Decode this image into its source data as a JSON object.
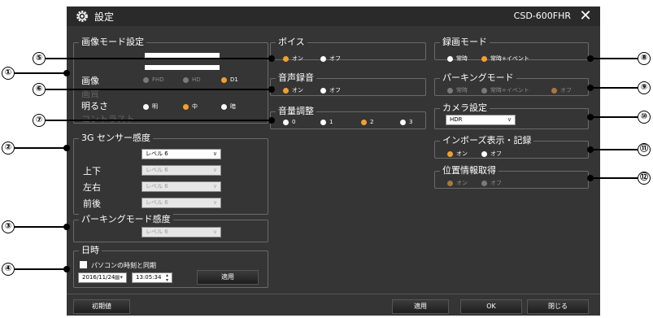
{
  "title": "設定",
  "model": "CSD-600FHR",
  "close": "✕",
  "image_mode": {
    "legend": "画像モード設定",
    "rows": [
      {
        "label": "画像",
        "options": [
          "FHD",
          "HD",
          "D1"
        ],
        "selected": 2
      },
      {
        "label": "明るさ",
        "options": [
          "明",
          "中",
          "暗"
        ],
        "selected": 1
      }
    ],
    "hidden_label_1": "画質",
    "hidden_label_2": "コントラスト"
  },
  "voice": {
    "legend": "ボイス",
    "options": [
      "オン",
      "オフ"
    ],
    "selected": 0
  },
  "audio_rec": {
    "legend": "音声録音",
    "options": [
      "オン",
      "オフ"
    ],
    "selected": 0
  },
  "volume": {
    "legend": "音量調整",
    "options": [
      "0",
      "1",
      "2",
      "3"
    ],
    "selected": 2
  },
  "rec_mode": {
    "legend": "録画モード",
    "options": [
      "常時",
      "常時+イベント"
    ],
    "selected": 1
  },
  "parking_mode": {
    "legend": "パーキングモード",
    "options": [
      "常時",
      "常時+イベント",
      "オフ"
    ],
    "selected": 2
  },
  "camera": {
    "legend": "カメラ設定",
    "value": "HDR"
  },
  "inbose": {
    "legend": "インボーズ表示・記録",
    "options": [
      "オン",
      "オフ"
    ],
    "selected": 0
  },
  "location": {
    "legend": "位置情報取得",
    "options": [
      "オン",
      "オフ"
    ],
    "selected": 0
  },
  "g_sensor": {
    "legend": "3G センサー感度",
    "main_value": "レベル 6",
    "rows": [
      {
        "label": "上下",
        "value": "レベル 6"
      },
      {
        "label": "左右",
        "value": "レベル 6"
      },
      {
        "label": "前後",
        "value": "レベル 6"
      }
    ]
  },
  "parking_sens": {
    "legend": "パーキングモード感度",
    "value": "レベル 6"
  },
  "datetime": {
    "legend": "日時",
    "sync_label": "パソコンの時刻と同期",
    "date": "2016/11/24",
    "time": "13:05:34",
    "apply": "適用"
  },
  "footer": {
    "defaults": "初期値",
    "apply": "適用",
    "ok": "OK",
    "close": "閉じる"
  },
  "callouts": [
    "①",
    "②",
    "③",
    "④",
    "⑤",
    "⑥",
    "⑦",
    "⑧",
    "⑨",
    "⑩",
    "⑪",
    "⑫"
  ]
}
